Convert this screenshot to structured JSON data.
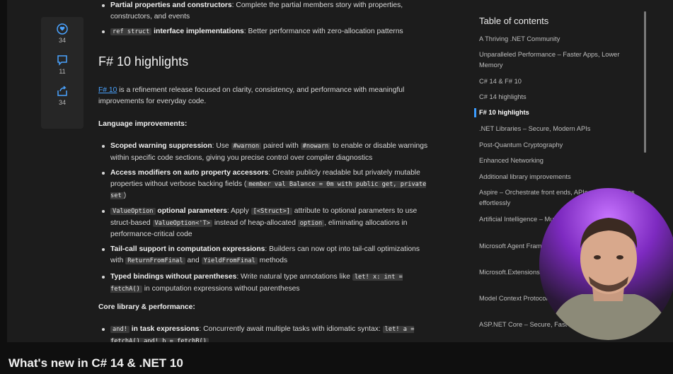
{
  "video": {
    "title": "What's new in C# 14 & .NET 10"
  },
  "rail": {
    "likes": "34",
    "comments": "11",
    "shares": "34"
  },
  "article": {
    "top_items": [
      {
        "bold": "Partial properties and constructors",
        "text": ": Complete the partial members story with properties, constructors, and events"
      },
      {
        "code": "ref struct",
        "bold": " interface implementations",
        "text": ": Better performance with zero-allocation patterns"
      }
    ],
    "heading": "F# 10 highlights",
    "intro_link": "F# 10",
    "intro_text": " is a refinement release focused on clarity, consistency, and performance with meaningful improvements for everyday code.",
    "subheading_lang": "Language improvements:",
    "lang_items": [
      {
        "bold": "Scoped warning suppression",
        "t1": ": Use ",
        "c1": "#warnon",
        "t2": " paired with ",
        "c2": "#nowarn",
        "t3": " to enable or disable warnings within specific code sections, giving you precise control over compiler diagnostics"
      },
      {
        "bold": "Access modifiers on auto property accessors",
        "t1": ": Create publicly readable but privately mutable properties without verbose backing fields (",
        "c1": "member val Balance = 0m with public get, private set",
        "t2": ")"
      },
      {
        "c0": "ValueOption",
        "bold": " optional parameters",
        "t1": ": Apply ",
        "c1": "[<Struct>]",
        "t2": " attribute to optional parameters to use struct-based ",
        "c2": "ValueOption<'T>",
        "t3": " instead of heap-allocated ",
        "c3": "option",
        "t4": ", eliminating allocations in performance-critical code"
      },
      {
        "bold": "Tail-call support in computation expressions",
        "t1": ": Builders can now opt into tail-call optimizations with ",
        "c1": "ReturnFromFinal",
        "t2": " and ",
        "c2": "YieldFromFinal",
        "t3": " methods"
      },
      {
        "bold": "Typed bindings without parentheses",
        "t1": ": Write natural type annotations like ",
        "c1": "let! x: int = fetchA()",
        "t2": " in computation expressions without parentheses"
      }
    ],
    "subheading_core": "Core library & performance:",
    "core_items": [
      {
        "c0": "and!",
        "bold": " in task expressions",
        "t1": ": Concurrently await multiple tasks with idiomatic syntax: ",
        "c1": "let! a = fetchA() and! b = fetchB()"
      }
    ]
  },
  "toc": {
    "title": "Table of contents",
    "items": [
      {
        "label": "A Thriving .NET Community"
      },
      {
        "label": "Unparalleled Performance – Faster Apps, Lower Memory"
      },
      {
        "label": "C# 14 & F# 10"
      },
      {
        "label": "C# 14 highlights"
      },
      {
        "label": "F# 10 highlights",
        "active": true
      },
      {
        "label": ".NET Libraries – Secure, Modern APIs"
      },
      {
        "label": "Post-Quantum Cryptography"
      },
      {
        "label": "Enhanced Networking"
      },
      {
        "label": "Additional library improvements"
      },
      {
        "label": "Aspire – Orchestrate front ends, APIs, and databases effortlessly"
      },
      {
        "label": "Artificial Intelligence – Multi-Agent Systems"
      },
      {
        "label": "Microsoft Agent Framework – Agent Systems"
      },
      {
        "label": "Microsoft.Extensions.AI – AI Applications"
      },
      {
        "label": "Model Context Protocol with Tools and Services"
      },
      {
        "label": "ASP.NET Core – Secure, Fast"
      }
    ]
  },
  "colors": {
    "link": "#4aa3ff",
    "accent": "#3b9cff",
    "background": "#1c1c1c"
  }
}
